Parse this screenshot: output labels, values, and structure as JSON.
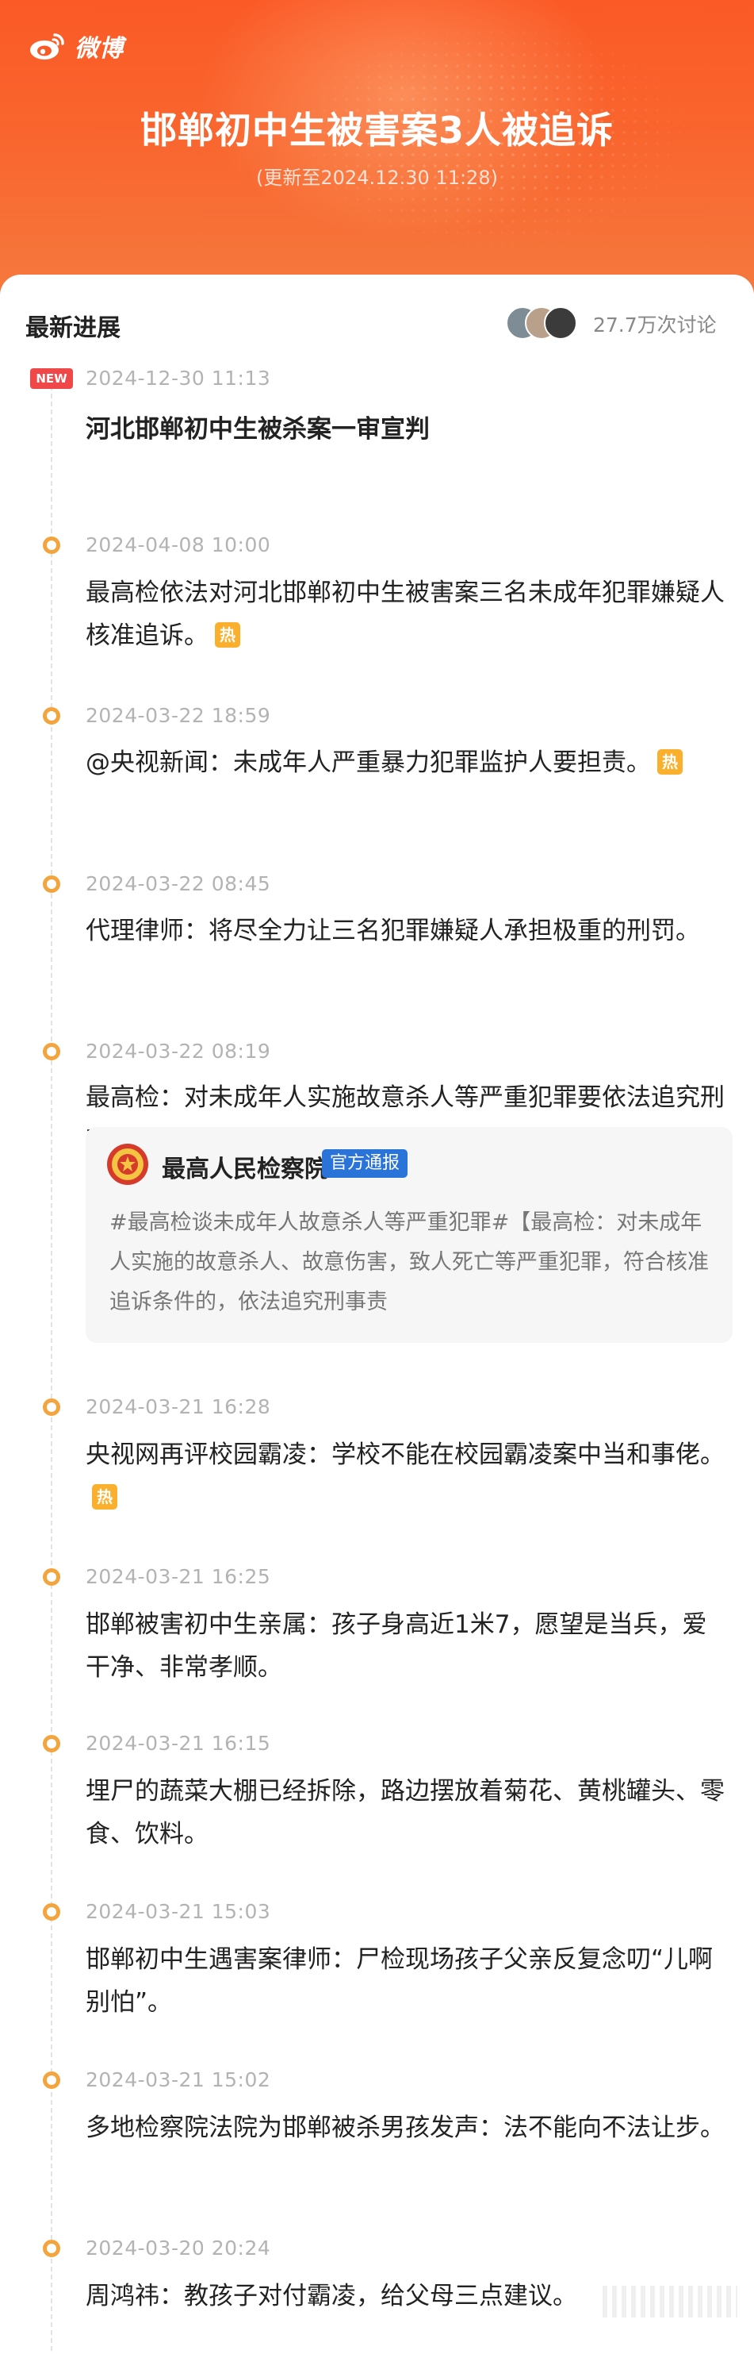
{
  "app": {
    "logo_text": "微博"
  },
  "header": {
    "title": "邯郸初中生被害案3人被追诉",
    "subtitle": "(更新至2024.12.30  11:28)"
  },
  "section": {
    "title": "最新进展",
    "discussion_count": "27.7万次讨论"
  },
  "badges": {
    "new": "NEW",
    "hot": "热"
  },
  "timeline": [
    {
      "time": "2024-12-30 11:13",
      "text": "河北邯郸初中生被杀案一审宣判",
      "hot": false
    },
    {
      "time": "2024-04-08 10:00",
      "text": "最高检依法对河北邯郸初中生被害案三名未成年犯罪嫌疑人核准追诉。",
      "hot": true
    },
    {
      "time": "2024-03-22 18:59",
      "text": "@央视新闻：未成年人严重暴力犯罪监护人要担责。",
      "hot": true
    },
    {
      "time": "2024-03-22 08:45",
      "text": "代理律师：将尽全力让三名犯罪嫌疑人承担极重的刑罚。",
      "hot": false
    },
    {
      "time": "2024-03-22 08:19",
      "text": "最高检：对未成年人实施故意杀人等严重犯罪要依法追究刑事责任。",
      "hot": true
    },
    {
      "time": "2024-03-21 16:28",
      "text": "央视网再评校园霸凌：学校不能在校园霸凌案中当和事佬。",
      "hot": true
    },
    {
      "time": "2024-03-21 16:25",
      "text": "邯郸被害初中生亲属：孩子身高近1米7，愿望是当兵，爱干净、非常孝顺。",
      "hot": false
    },
    {
      "time": "2024-03-21 16:15",
      "text": "埋尸的蔬菜大棚已经拆除，路边摆放着菊花、黄桃罐头、零食、饮料。",
      "hot": false
    },
    {
      "time": "2024-03-21 15:03",
      "text": "邯郸初中生遇害案律师：尸检现场孩子父亲反复念叨“儿啊别怕”。",
      "hot": false
    },
    {
      "time": "2024-03-21 15:02",
      "text": "多地检察院法院为邯郸被杀男孩发声：法不能向不法让步。",
      "hot": false
    },
    {
      "time": "2024-03-20 20:24",
      "text": "周鸿祎：教孩子对付霸凌，给父母三点建议。",
      "hot": false
    }
  ],
  "quote_card": {
    "name": "最高人民检察院",
    "tag": "官方通报",
    "body": "#最高检谈未成年人故意杀人等严重犯罪#【最高检：对未成年人实施的故意杀人、故意伤害，致人死亡等严重犯罪，符合核准追诉条件的，依法追究刑事责"
  },
  "colors": {
    "header_orange": "#fb5a26",
    "timeline_dot": "#f4a43c",
    "hot_badge": "#fbb02d",
    "new_badge": "#f04848",
    "official_tag": "#2a73d8"
  }
}
